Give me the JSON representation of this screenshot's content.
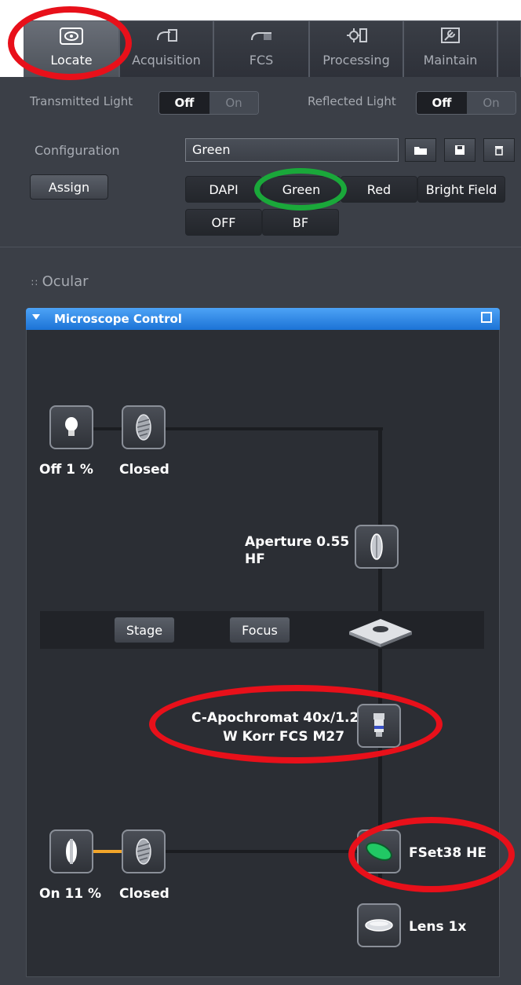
{
  "tabs": [
    {
      "label": "Locate",
      "icon": "eye-icon"
    },
    {
      "label": "Acquisition",
      "icon": "camera-icon"
    },
    {
      "label": "FCS",
      "icon": "fcs-icon"
    },
    {
      "label": "Processing",
      "icon": "processing-icon"
    },
    {
      "label": "Maintain",
      "icon": "maintain-icon"
    }
  ],
  "light": {
    "transmitted_label": "Transmitted Light",
    "reflected_label": "Reflected Light",
    "off": "Off",
    "on": "On"
  },
  "config": {
    "label": "Configuration",
    "value": "Green",
    "assign": "Assign",
    "presets": [
      "DAPI",
      "Green",
      "Red",
      "Bright Field",
      "OFF",
      "BF"
    ]
  },
  "ocular": "Ocular",
  "panel": {
    "title": "Microscope Control",
    "top_lamp_status": "Off  1 %",
    "top_shutter_status": "Closed",
    "aperture_line1": "Aperture  0.55",
    "aperture_line2": "HF",
    "stage": "Stage",
    "focus": "Focus",
    "objective_line1": "C-Apochromat 40x/1.2",
    "objective_line2": "W Korr FCS M27",
    "filter": "FSet38 HE",
    "lens": "Lens 1x",
    "bottom_lamp_status": "On  11 %",
    "bottom_shutter_status": "Closed"
  },
  "colors": {
    "annotation_red": "#e8101a",
    "annotation_green": "#1aa83a",
    "header_blue": "#2b86e8",
    "filter_green": "#21c864",
    "bright_field_line": "#f2a52a"
  }
}
